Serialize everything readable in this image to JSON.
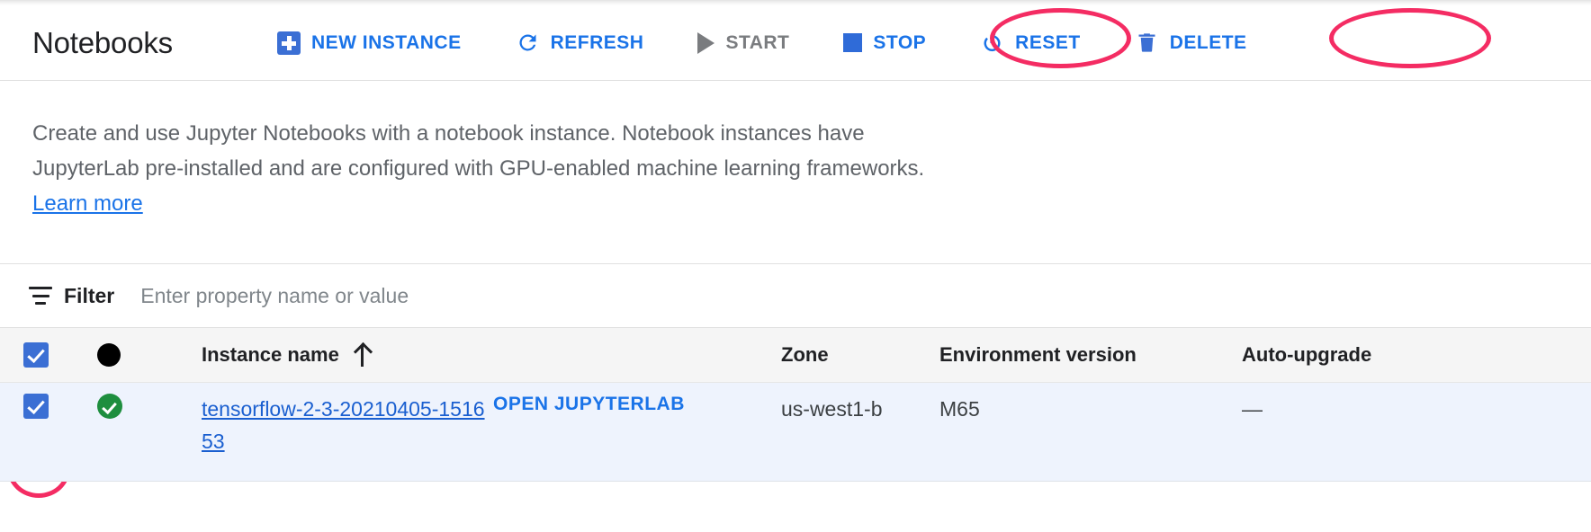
{
  "header": {
    "title": "Notebooks",
    "toolbar": [
      {
        "id": "new-instance",
        "label": "NEW INSTANCE",
        "icon": "plus-icon",
        "state": "enabled",
        "annotated": false
      },
      {
        "id": "refresh",
        "label": "REFRESH",
        "icon": "refresh-icon",
        "state": "enabled",
        "annotated": false
      },
      {
        "id": "start",
        "label": "START",
        "icon": "play-icon",
        "state": "disabled",
        "annotated": false
      },
      {
        "id": "stop",
        "label": "STOP",
        "icon": "stop-icon",
        "state": "enabled",
        "annotated": true
      },
      {
        "id": "reset",
        "label": "RESET",
        "icon": "power-icon",
        "state": "enabled",
        "annotated": false
      },
      {
        "id": "delete",
        "label": "DELETE",
        "icon": "trash-icon",
        "state": "enabled",
        "annotated": true
      }
    ]
  },
  "description": {
    "text": "Create and use Jupyter Notebooks with a notebook instance. Notebook instances have JupyterLab pre-installed and are configured with GPU-enabled machine learning frameworks. ",
    "link_label": "Learn more"
  },
  "filter": {
    "icon": "filter-icon",
    "label": "Filter",
    "placeholder": "Enter property name or value",
    "value": ""
  },
  "table": {
    "select_all_checked": true,
    "status_header_icon": "status-dot-icon",
    "sort_column": "Instance name",
    "sort_direction": "ascending",
    "columns": [
      {
        "key": "name",
        "label": "Instance name"
      },
      {
        "key": "action",
        "label": ""
      },
      {
        "key": "zone",
        "label": "Zone"
      },
      {
        "key": "env",
        "label": "Environment version"
      },
      {
        "key": "auto",
        "label": "Auto-upgrade"
      }
    ],
    "rows": [
      {
        "selected": true,
        "status": "running",
        "status_icon": "check-circle-icon",
        "name": "tensorflow-2-3-20210405-151653",
        "action_label": "OPEN JUPYTERLAB",
        "zone": "us-west1-b",
        "env": "M65",
        "auto": "—"
      }
    ]
  },
  "annotations": {
    "color": "#f42c63",
    "targets": [
      "stop-button",
      "delete-button",
      "row-checkbox"
    ]
  },
  "colors": {
    "link_blue": "#1a73e8",
    "accent_blue": "#3b6fd4",
    "status_green": "#1e8e3e",
    "annotation_pink": "#f42c63",
    "row_selected_bg": "#eef3fd",
    "header_bg": "#f5f5f5"
  }
}
